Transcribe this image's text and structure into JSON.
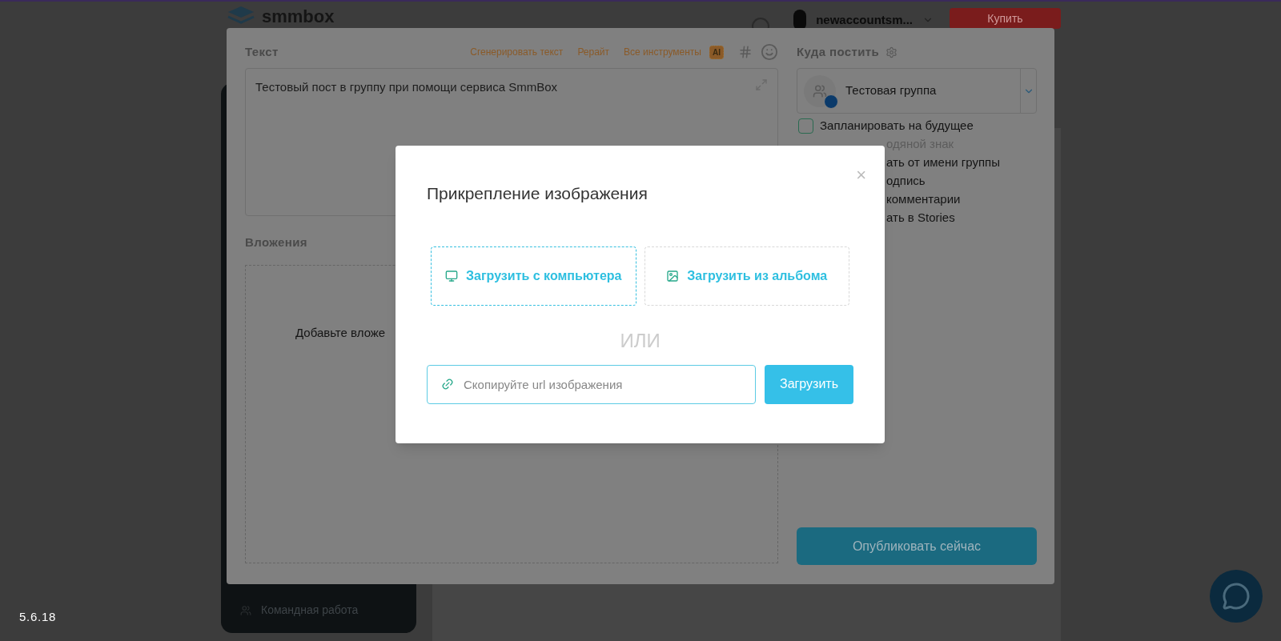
{
  "header": {
    "logo": "smmbox",
    "username": "newaccountsm...",
    "buy_button": "Купить"
  },
  "sidebar": {
    "items": [
      {
        "label": "Командная работа"
      }
    ]
  },
  "version": "5.6.18",
  "editor": {
    "text_label": "Текст",
    "tools": [
      "Сгенерировать текст",
      "Рерайт",
      "Все инструменты"
    ],
    "ai_badge": "AI",
    "text_value": "Тестовый пост в группу при помощи сервиса SmmBox",
    "attachments_label": "Вложения",
    "attachments_hint": "Добавьте вложе",
    "target_label": "Куда постить",
    "group": "Тестовая группа",
    "options": [
      {
        "kind": "checkbox",
        "label": "Запланировать на будущее",
        "checked": false
      },
      {
        "kind": "covered",
        "label": "одяной знак",
        "disabled": true
      },
      {
        "kind": "covered",
        "label": "ать от имени группы",
        "disabled": false
      },
      {
        "kind": "covered",
        "label": "одпись",
        "disabled": false
      },
      {
        "kind": "covered",
        "label": "комментарии",
        "disabled": false
      },
      {
        "kind": "covered",
        "label": "ать в Stories",
        "disabled": false
      }
    ],
    "publish_button": "Опубликовать сейчас"
  },
  "modal": {
    "title": "Прикрепление изображения",
    "close": "×",
    "sources": [
      {
        "label": "Загрузить с компьютера",
        "kind": "computer",
        "selected": true
      },
      {
        "label": "Загрузить из альбома",
        "kind": "album",
        "selected": false
      }
    ],
    "separator": "ИЛИ",
    "url_placeholder": "Скопируйте url изображения",
    "upload_button": "Загрузить"
  }
}
